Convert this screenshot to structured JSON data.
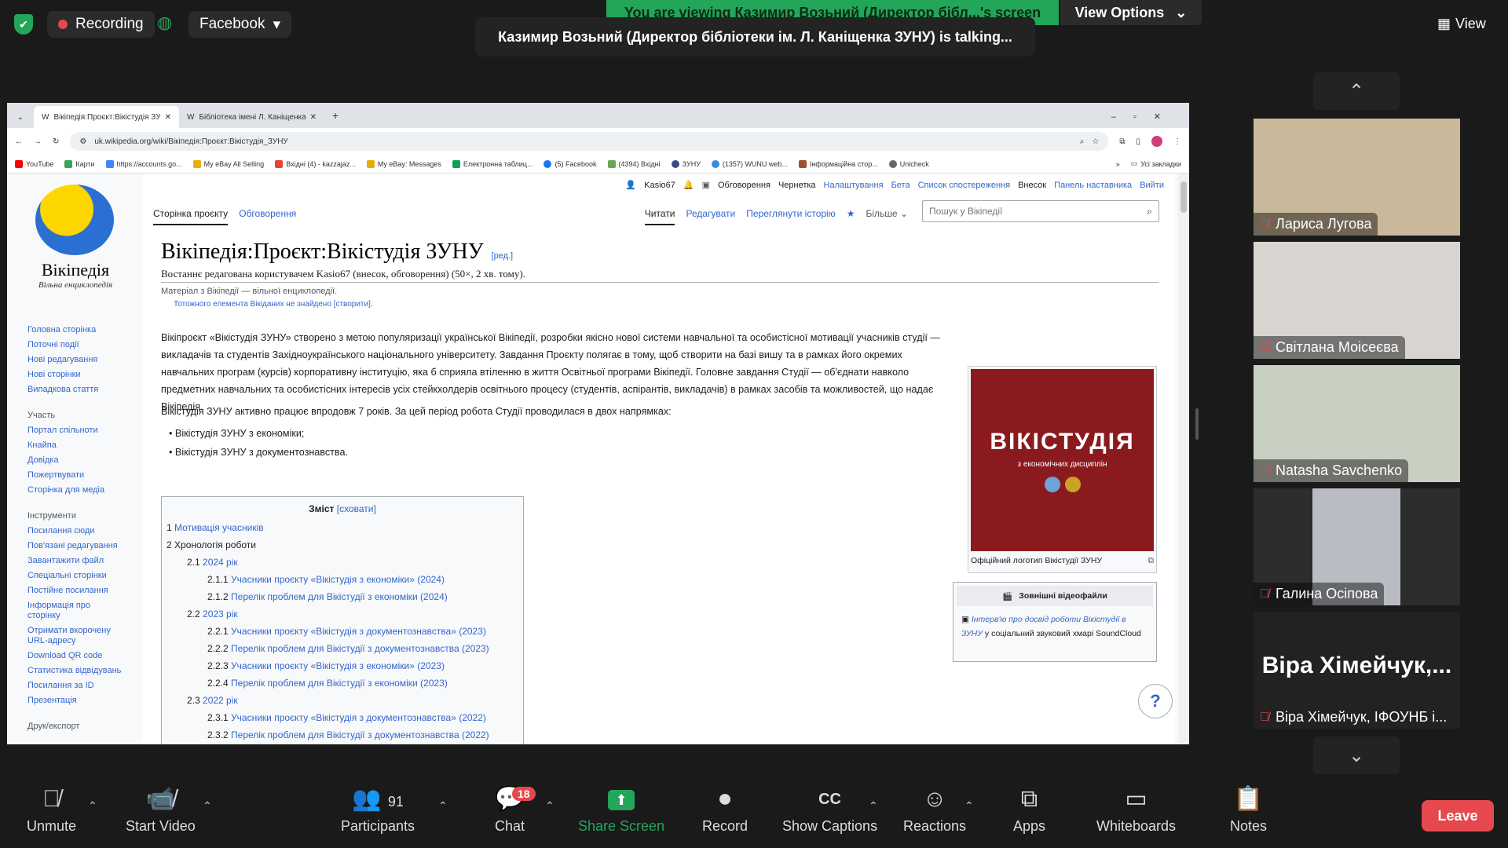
{
  "zoom": {
    "recording_label": "Recording",
    "facebook_label": "Facebook",
    "share_banner": "You are viewing Казимир Возьний (Директор бібл...'s screen",
    "view_options_label": "View Options",
    "talking": "Казимир Возьний (Директор бібліотеки ім. Л. Каніщенка ЗУНУ) is talking...",
    "view_label": "View",
    "participants": [
      {
        "name": "Лариса Лугова"
      },
      {
        "name": "Світлана Моісеєва"
      },
      {
        "name": "Natasha Savchenko"
      },
      {
        "name": "Галина Осіпова"
      },
      {
        "name": "Віра Хімейчук, ІФОУНБ і...",
        "big": "Віра Хімейчук,..."
      }
    ],
    "toolbar": {
      "unmute": "Unmute",
      "start_video": "Start Video",
      "participants": "Participants",
      "participants_count": "91",
      "chat": "Chat",
      "chat_badge": "18",
      "share_screen": "Share Screen",
      "record": "Record",
      "captions": "Show Captions",
      "reactions": "Reactions",
      "apps": "Apps",
      "whiteboards": "Whiteboards",
      "notes": "Notes",
      "leave": "Leave"
    }
  },
  "browser": {
    "tabs": [
      "Вікіпедія:Проєкт:Вікістудія ЗУ",
      "Бібліотека імені Л. Каніщенка"
    ],
    "url": "uk.wikipedia.org/wiki/Вікіпедія:Проєкт:Вікістудія_ЗУНУ",
    "bookmarks": [
      "YouTube",
      "Карти",
      "https://accounts.go...",
      "My eBay All Selling",
      "Вхідні (4) - kazzajaz...",
      "My eBay: Messages",
      "Електронна таблиц...",
      "(5) Facebook",
      "(4394) Вхідні",
      "ЗУНУ",
      "(1357) WUNU web...",
      "Інформаційна стор...",
      "Unicheck"
    ],
    "all_bookmarks": "Усі закладки"
  },
  "wiki": {
    "wordmark": "Вікіпедія",
    "tagline": "Вільна енциклопедія",
    "nav": [
      "Головна сторінка",
      "Поточні події",
      "Нові редагування",
      "Нові сторінки",
      "Випадкова стаття"
    ],
    "nav_h1": "Участь",
    "nav2": [
      "Портал спільноти",
      "Кнайпа",
      "Довідка",
      "Пожертвувати",
      "Сторінка для медіа"
    ],
    "nav_h2": "Інструменти",
    "nav3": [
      "Посилання сюди",
      "Пов'язані редагування",
      "Завантажити файл",
      "Спеціальні сторінки",
      "Постійне посилання",
      "Інформація про сторінку",
      "Отримати вкорочену URL-адресу",
      "Download QR code",
      "Статистика відвідувань",
      "Посилання за ID",
      "Презентація"
    ],
    "nav_h3": "Друк/експорт",
    "user": [
      "Kasio67",
      "Обговорення",
      "Чернетка",
      "Налаштування",
      "Бета",
      "Список спостереження",
      "Внесок",
      "Панель наставника",
      "Вийти"
    ],
    "tab_project": "Сторінка проєкту",
    "tab_talk": "Обговорення",
    "tab_read": "Читати",
    "tab_edit": "Редагувати",
    "tab_history": "Переглянути історію",
    "tab_more": "Більше",
    "search_placeholder": "Пошук у Вікіпедії",
    "title": "Вікіпедія:Проєкт:Вікістудія ЗУНУ",
    "edit_link": "[ред.]",
    "last_edit": "Востаннє редагована користувачем Kasio67 (внесок, обговорення) (50×, 2 хв. тому).",
    "from": "Матеріал з Вікіпедії — вільної енциклопедії.",
    "notfound": "Тотожного елемента Вікіданих не знайдено [створити].",
    "p1": "Вікіпроєкт «Вікістудія ЗУНУ» створено з метою популяризації української Вікіпедії, розробки якісно нової системи навчальної та особистісної мотивації учасників студії — викладачів та студентів Західноукраїнського національного університету. Завдання Проєкту полягає в тому, щоб створити на базі вишу та в рамках його окремих навчальних програм (курсів) корпоративну інституцію, яка б сприяла втіленню в життя Освітньої програми Вікіпедії. Головне завдання Студії — об'єднати навколо предметних навчальних та особистісних інтересів усіх стейкхолдерів освітнього процесу (студентів, аспірантів, викладачів) в рамках засобів та можливостей, що надає Вікіпедія.",
    "p2": "Вікістудія ЗУНУ активно працює впродовж 7 років. За цей період робота Студії проводилася в двох напрямках:",
    "bullets": [
      "Вікістудія ЗУНУ з економіки;",
      "Вікістудія ЗУНУ з документознавства."
    ],
    "toc_title": "Зміст",
    "toc_hide": "[сховати]",
    "toc": [
      {
        "n": "1",
        "t": "Мотивація учасників"
      },
      {
        "n": "2",
        "t": "Хронологія роботи"
      },
      {
        "n": "2.1",
        "t": "2024 рік"
      },
      {
        "n": "2.1.1",
        "t": "Учасники проєкту «Вікістудія з економіки» (2024)"
      },
      {
        "n": "2.1.2",
        "t": "Перелік проблем для Вікістудії з економіки (2024)"
      },
      {
        "n": "2.2",
        "t": "2023 рік"
      },
      {
        "n": "2.2.1",
        "t": "Учасники проєкту «Вікістудія з документознавства» (2023)"
      },
      {
        "n": "2.2.2",
        "t": "Перелік проблем для Вікістудії з документознавства (2023)"
      },
      {
        "n": "2.2.3",
        "t": "Учасники проєкту «Вікістудія з економіки» (2023)"
      },
      {
        "n": "2.2.4",
        "t": "Перелік проблем для Вікістудії з економіки (2023)"
      },
      {
        "n": "2.3",
        "t": "2022 рік"
      },
      {
        "n": "2.3.1",
        "t": "Учасники проєкту «Вікістудія з документознавства» (2022)"
      },
      {
        "n": "2.3.2",
        "t": "Перелік проблем для Вікістудії з документознавства (2022)"
      }
    ],
    "logo_big": "ВІКІСТУДІЯ",
    "logo_sub": "з економічних дисциплін",
    "logo_caption": "Офіційний логотип Вікістудії ЗУНУ",
    "ext_title": "Зовнішні відеофайли",
    "ext_link": "Інтерв'ю про досвід роботи Вікістудії в ЗУНУ",
    "ext_rest": "у соціальний звуковий хмарі SoundCloud",
    "help": "?"
  }
}
